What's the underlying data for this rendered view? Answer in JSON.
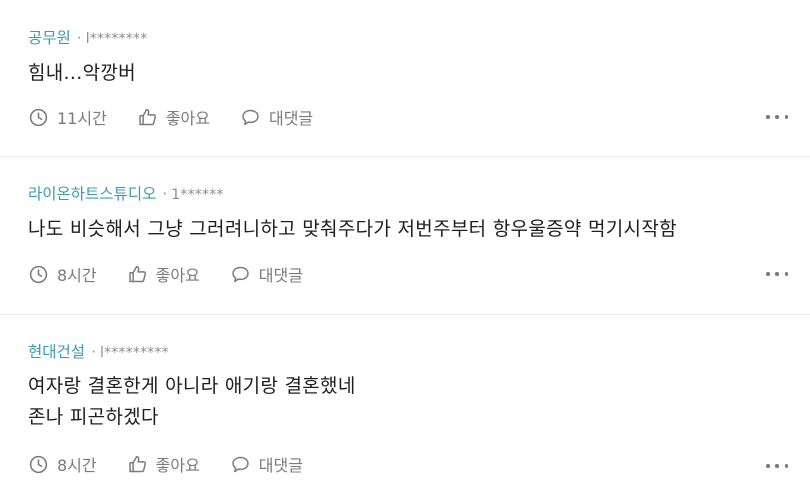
{
  "comments": [
    {
      "author": "공무원",
      "separator": "·",
      "user_id": "l********",
      "text": "힘내...악깡버",
      "time": "11시간",
      "like_label": "좋아요",
      "reply_label": "대댓글"
    },
    {
      "author": "라이온하트스튜디오",
      "separator": "·",
      "user_id": "1******",
      "text": "나도 비슷해서 그냥 그러려니하고 맞춰주다가 저번주부터 항우울증약 먹기시작함",
      "time": "8시간",
      "like_label": "좋아요",
      "reply_label": "대댓글"
    },
    {
      "author": "현대건설",
      "separator": "·",
      "user_id": "l*********",
      "text": "여자랑 결혼한게 아니라 애기랑 결혼했네\n존나 피곤하겠다",
      "time": "8시간",
      "like_label": "좋아요",
      "reply_label": "대댓글"
    }
  ],
  "icons": {
    "time": "clock-icon",
    "like": "thumbs-up-icon",
    "reply": "speech-bubble-icon",
    "more": "more-horizontal-icon"
  },
  "colors": {
    "author": "#3a9bb3",
    "text": "#1e1e1e",
    "muted": "#7a7a7a",
    "divider": "#ececec"
  }
}
